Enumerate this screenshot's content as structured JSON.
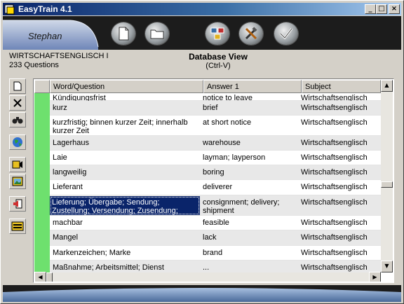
{
  "window": {
    "title": "EasyTrain 4.1",
    "controls": {
      "minimize": "_",
      "maximize": "□",
      "close": "×"
    }
  },
  "header": {
    "user": "Stephan",
    "buttons": [
      "new-document-icon",
      "open-folder-icon",
      "group-icon",
      "tools-icon",
      "checkmark-icon"
    ]
  },
  "info": {
    "course": "WIRTSCHAFTSENGLISCH I",
    "question_count": "233 Questions",
    "view_title": "Database View",
    "view_shortcut": "(Ctrl-V)"
  },
  "toolbar": [
    "new-icon",
    "delete-icon",
    "find-icon",
    "globe-icon",
    "audio-icon",
    "image-icon",
    "speaker-icon",
    "list-icon"
  ],
  "grid": {
    "columns": [
      "Word/Question",
      "Answer 1",
      "Subject"
    ],
    "rows": [
      {
        "q": "Kündigungsfrist",
        "a": "notice to leave",
        "s": "Wirtschaftsenglisch"
      },
      {
        "q": "kurz",
        "a": "brief",
        "s": "Wirtschaftsenglisch"
      },
      {
        "q": "kurzfristig; binnen kurzer Zeit; innerhalb kurzer Zeit",
        "a": "at short notice",
        "s": "Wirtschaftsenglisch"
      },
      {
        "q": "Lagerhaus",
        "a": "warehouse",
        "s": "Wirtschaftsenglisch"
      },
      {
        "q": "Laie",
        "a": "layman; layperson",
        "s": "Wirtschaftsenglisch"
      },
      {
        "q": "langweilig",
        "a": "boring",
        "s": "Wirtschaftsenglisch"
      },
      {
        "q": "Lieferant",
        "a": "deliverer",
        "s": "Wirtschaftsenglisch"
      },
      {
        "q": "Lieferung; Übergabe; Sendung; Zustellung; Versendung; Zusendung; Uebergabe",
        "a": "consignment; delivery; shipment",
        "s": "Wirtschaftsenglisch"
      },
      {
        "q": "machbar",
        "a": "feasible",
        "s": "Wirtschaftsenglisch"
      },
      {
        "q": "Mangel",
        "a": "lack",
        "s": "Wirtschaftsenglisch"
      },
      {
        "q": "Markenzeichen; Marke",
        "a": "brand",
        "s": "Wirtschaftsenglisch"
      },
      {
        "q": "Maßnahme; Arbeitsmittel; Dienst",
        "a": "...",
        "s": "Wirtschaftsenglisch"
      }
    ],
    "selected_row": 7,
    "check_mark": "✓"
  },
  "colors": {
    "left_indicator": "#6ee06e",
    "selection": "#0a246a",
    "title_bar": "#0a246a"
  }
}
